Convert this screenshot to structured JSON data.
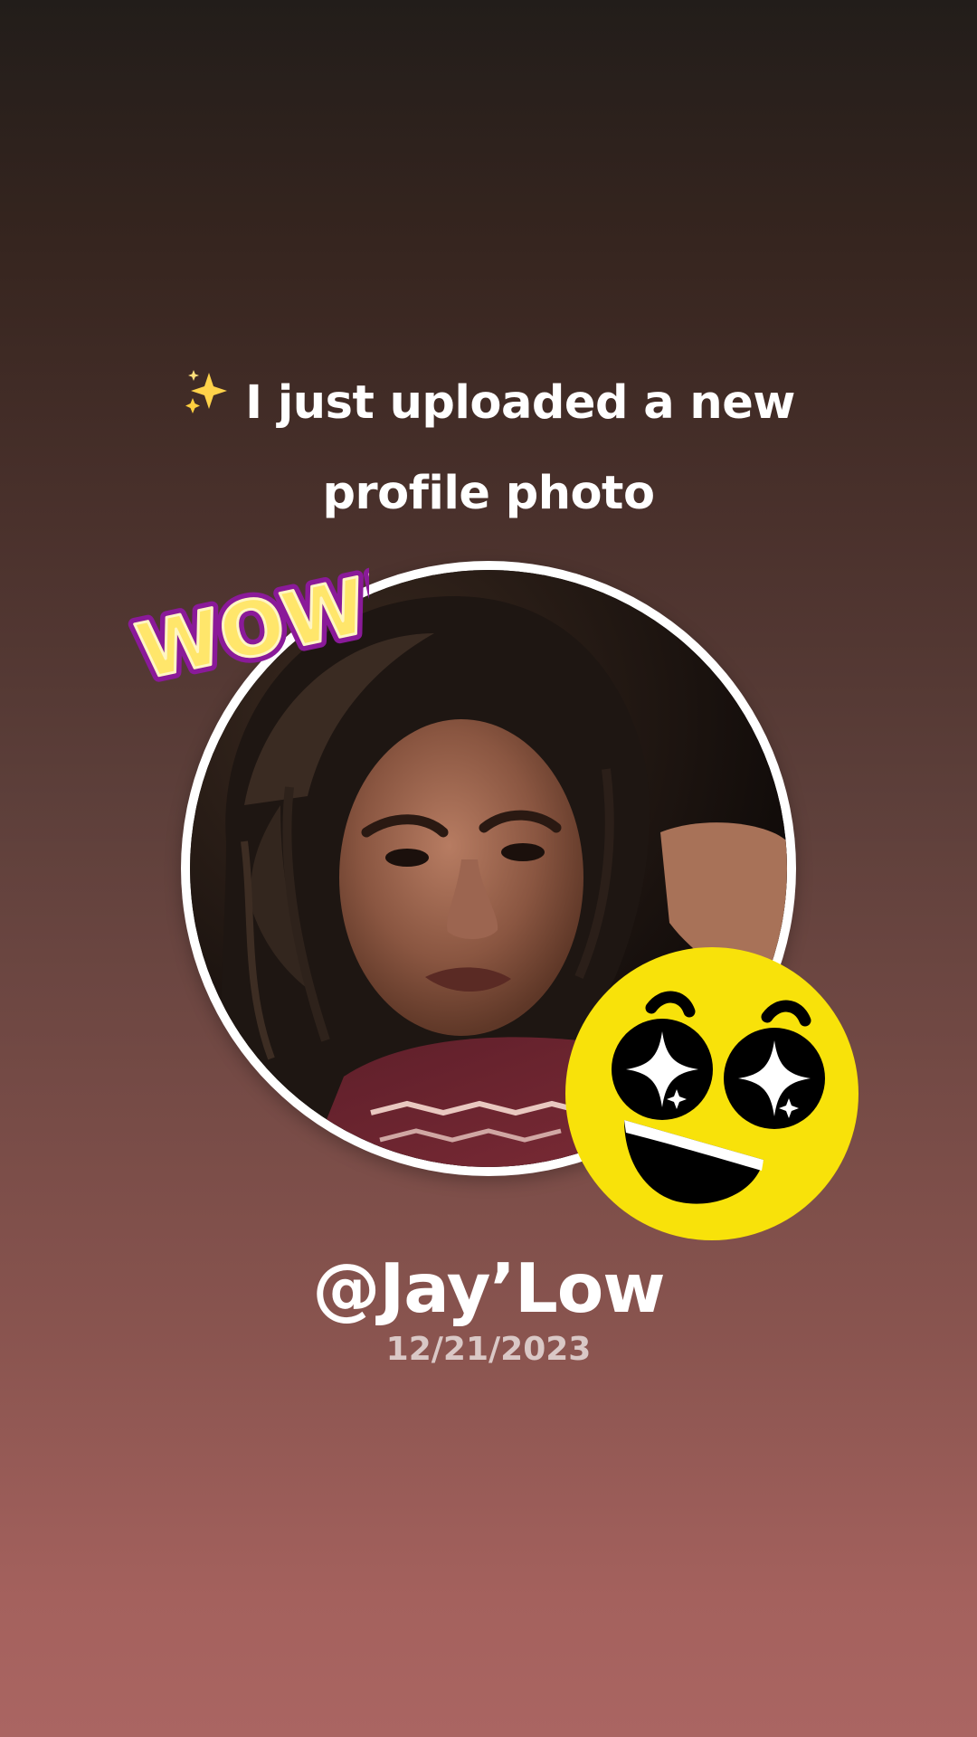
{
  "headline": {
    "line1": "I just uploaded a new",
    "line2": "profile photo",
    "leading_icon": "sparkles-icon"
  },
  "profile": {
    "photo_alt": "profile photo",
    "username": "@Jay’Low",
    "date": "12/21/2023"
  },
  "stickers": {
    "wow_text": "WOW!",
    "emoji": "star-struck-emoji"
  },
  "colors": {
    "background_top": "#221d1a",
    "background_bottom": "#aa6562",
    "text": "#ffffff",
    "ring": "#ffffff",
    "emoji_yellow": "#f8e20a",
    "sticker_yellow": "#ffe66b",
    "sticker_purple": "#8a1a99"
  }
}
